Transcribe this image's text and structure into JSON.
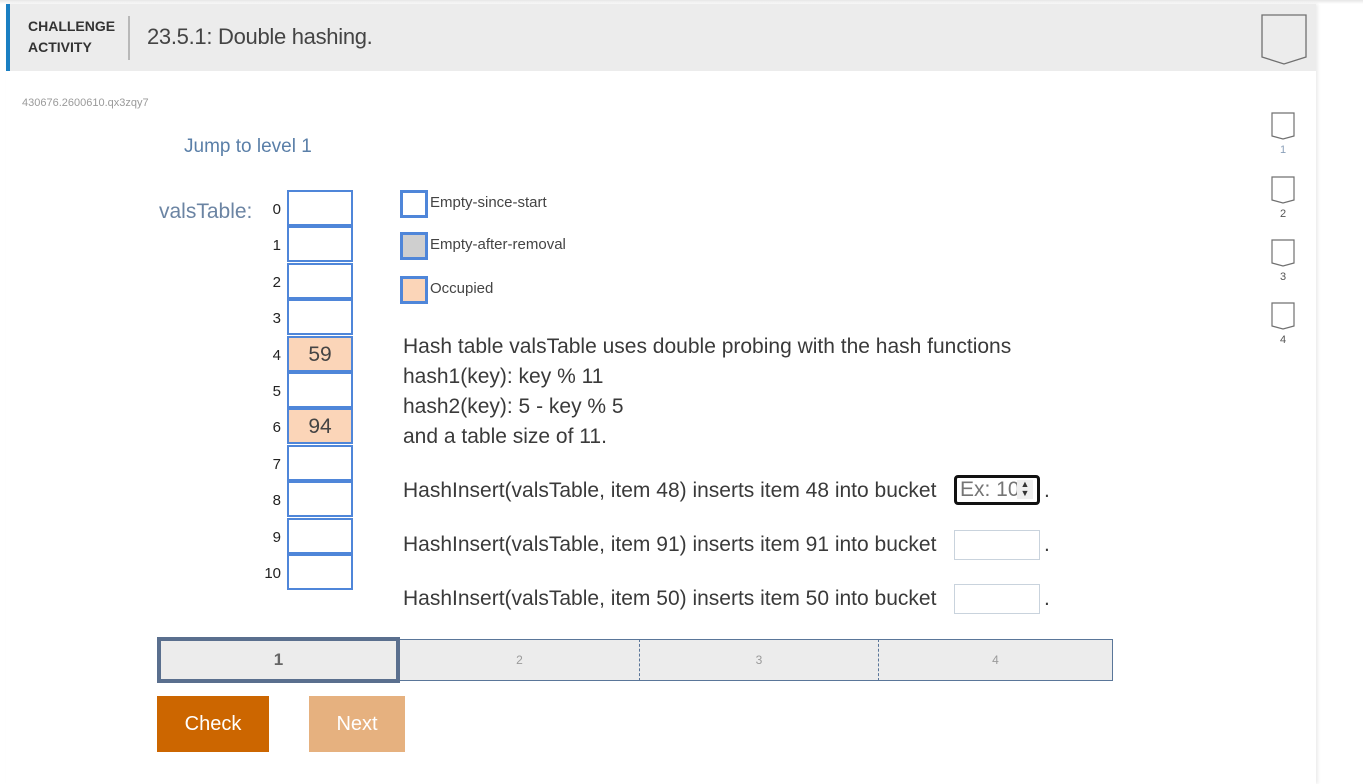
{
  "header": {
    "label_line1": "CHALLENGE",
    "label_line2": "ACTIVITY",
    "title": "23.5.1: Double hashing.",
    "completion_badge_icon": "pentagon-badge-icon"
  },
  "activity_id": "430676.2600610.qx3zqy7",
  "jump_link": "Jump to level 1",
  "side_levels": [
    {
      "label": "1",
      "icon": "pentagon-badge-icon"
    },
    {
      "label": "2",
      "icon": "pentagon-badge-icon"
    },
    {
      "label": "3",
      "icon": "pentagon-badge-icon"
    },
    {
      "label": "4",
      "icon": "pentagon-badge-icon"
    }
  ],
  "table": {
    "name_label": "valsTable:",
    "rows": [
      {
        "index": "0",
        "value": "",
        "state": "empty"
      },
      {
        "index": "1",
        "value": "",
        "state": "empty"
      },
      {
        "index": "2",
        "value": "",
        "state": "empty"
      },
      {
        "index": "3",
        "value": "",
        "state": "empty"
      },
      {
        "index": "4",
        "value": "59",
        "state": "occupied"
      },
      {
        "index": "5",
        "value": "",
        "state": "empty"
      },
      {
        "index": "6",
        "value": "94",
        "state": "occupied"
      },
      {
        "index": "7",
        "value": "",
        "state": "empty"
      },
      {
        "index": "8",
        "value": "",
        "state": "empty"
      },
      {
        "index": "9",
        "value": "",
        "state": "empty"
      },
      {
        "index": "10",
        "value": "",
        "state": "empty"
      }
    ]
  },
  "legend": [
    {
      "label": "Empty-since-start",
      "color": "#ffffff"
    },
    {
      "label": "Empty-after-removal",
      "color": "#cfcfcf"
    },
    {
      "label": "Occupied",
      "color": "#fbd5b8"
    }
  ],
  "description": [
    "Hash table valsTable uses double probing with the hash functions",
    "hash1(key): key % 11",
    "hash2(key): 5 - key % 5",
    "and a table size of 11."
  ],
  "questions": [
    {
      "text": "HashInsert(valsTable, item 48) inserts item 48 into bucket",
      "value": "",
      "placeholder": "Ex: 10",
      "focused": true
    },
    {
      "text": "HashInsert(valsTable, item 91) inserts item 91 into bucket",
      "value": "",
      "placeholder": "",
      "focused": false
    },
    {
      "text": "HashInsert(valsTable, item 50) inserts item 50 into bucket",
      "value": "",
      "placeholder": "",
      "focused": false
    }
  ],
  "progress_levels": [
    "1",
    "2",
    "3",
    "4"
  ],
  "current_level": "1",
  "buttons": {
    "check": "Check",
    "next": "Next"
  },
  "colors": {
    "accent_bar": "#1b7fc2",
    "check_button": "#cc6600",
    "next_button_disabled": "#e6b17f",
    "cell_border": "#4f86d9",
    "occupied": "#fbd5b8",
    "removed": "#cfcfcf"
  }
}
